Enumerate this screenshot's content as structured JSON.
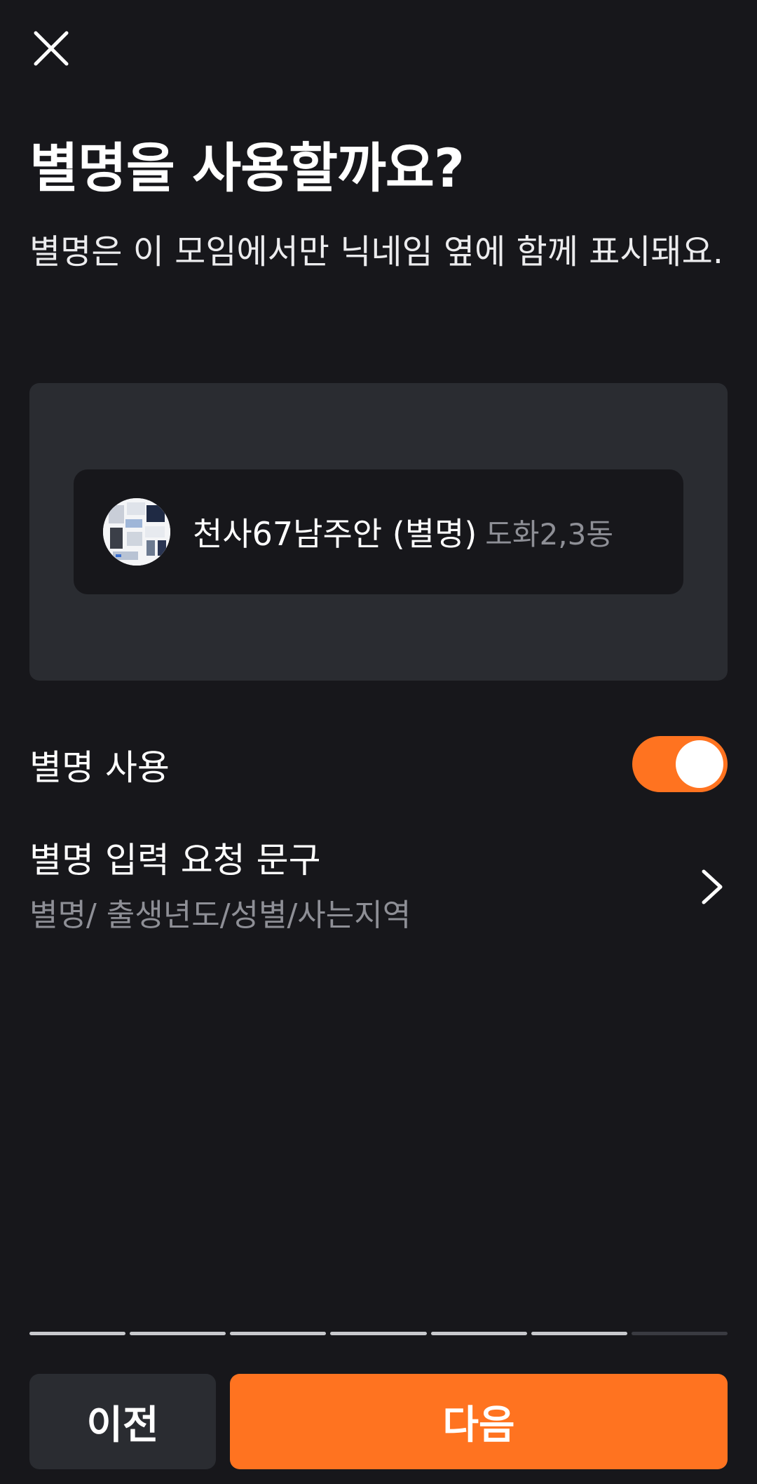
{
  "header": {
    "close_icon": "close-icon"
  },
  "title": "별명을 사용할까요?",
  "subtitle": "별명은 이 모임에서만 닉네임 옆에 함께 표시돼요.",
  "preview": {
    "avatar_icon": "avatar-thumbnail",
    "name": "천사67남주안 (별명)",
    "region": "도화2,3동"
  },
  "nickname_toggle": {
    "label": "별명 사용",
    "enabled": true,
    "accent_color": "#ff7320"
  },
  "request_phrase": {
    "label": "별명 입력 요청 문구",
    "value": "별명/ 출생년도/성별/사는지역",
    "icon": "chevron-right-icon"
  },
  "progress": {
    "completed_steps": 6,
    "total_steps": 7
  },
  "footer": {
    "prev_label": "이전",
    "next_label": "다음",
    "next_color": "#ff7320"
  }
}
